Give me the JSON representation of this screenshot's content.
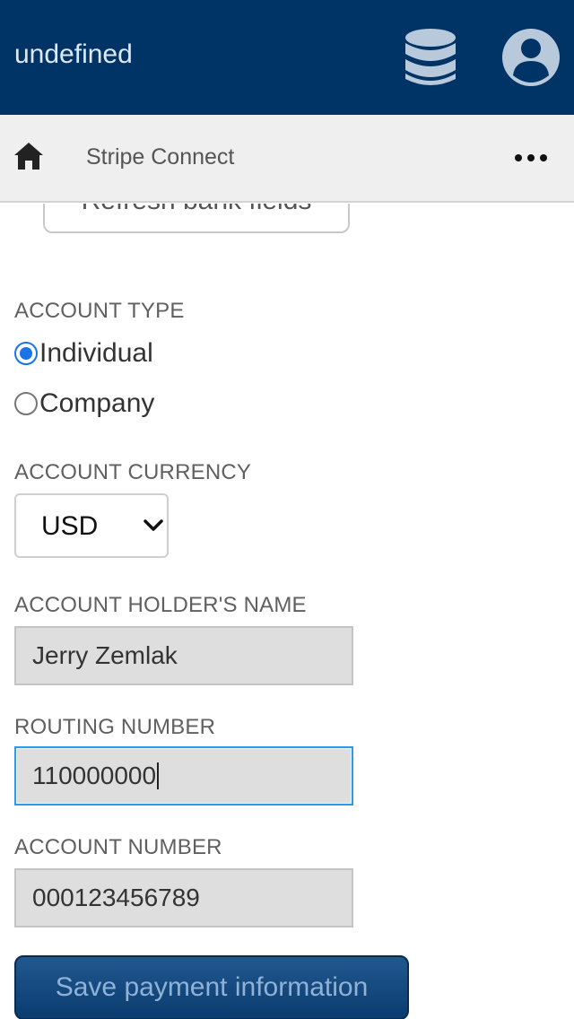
{
  "appbar": {
    "title": "undefined",
    "icons": {
      "database": "database-icon",
      "account": "user-circle-icon"
    },
    "bg_color": "#013466"
  },
  "subbar": {
    "title": "Stripe Connect",
    "icons": {
      "home": "home-icon",
      "more": "more-horizontal-icon"
    }
  },
  "form": {
    "refresh_label": "Refresh bank fields",
    "account_type": {
      "label": "ACCOUNT TYPE",
      "options": [
        {
          "label": "Individual",
          "checked": true
        },
        {
          "label": "Company",
          "checked": false
        }
      ]
    },
    "currency": {
      "label": "ACCOUNT CURRENCY",
      "selected": "USD"
    },
    "holder_name": {
      "label": "ACCOUNT HOLDER'S NAME",
      "value": "Jerry Zemlak"
    },
    "routing_number": {
      "label": "ROUTING NUMBER",
      "value": "110000000"
    },
    "account_number": {
      "label": "ACCOUNT NUMBER",
      "value": "000123456789"
    },
    "save_label": "Save payment information"
  },
  "colors": {
    "accent": "#1a73e8",
    "focus": "#2a9be6",
    "primary_button": "#0b3c70"
  }
}
